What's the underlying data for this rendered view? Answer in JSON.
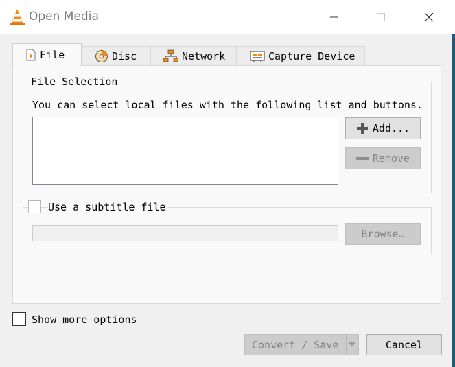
{
  "window": {
    "title": "Open Media",
    "icon": "vlc-cone-icon"
  },
  "tabs": [
    {
      "label": "File",
      "icon": "file-icon"
    },
    {
      "label": "Disc",
      "icon": "disc-icon"
    },
    {
      "label": "Network",
      "icon": "network-icon"
    },
    {
      "label": "Capture Device",
      "icon": "capture-device-icon"
    }
  ],
  "file_selection": {
    "title": "File Selection",
    "description": "You can select local files with the following list and buttons.",
    "add_label": "Add...",
    "remove_label": "Remove"
  },
  "subtitle": {
    "checkbox_label": "Use a subtitle file",
    "browse_label": "Browse…",
    "path_value": ""
  },
  "footer": {
    "show_more_label": "Show more options",
    "convert_label": "Convert / Save",
    "cancel_label": "Cancel"
  }
}
